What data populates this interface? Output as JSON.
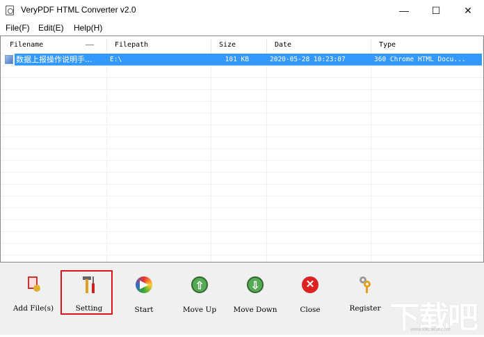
{
  "window": {
    "title": "VeryPDF HTML Converter v2.0",
    "minimize": "—",
    "maximize": "☐",
    "close": "✕"
  },
  "menu": [
    {
      "label": "File(F)"
    },
    {
      "label": "Edit(E)"
    },
    {
      "label": "Help(H)"
    }
  ],
  "columns": [
    "Filename",
    "Filepath",
    "Size",
    "Date",
    "Type"
  ],
  "rows": [
    {
      "filename": "数据上报操作说明手...",
      "filepath": "E:\\",
      "size": "101 KB",
      "date": "2020-05-28 10:23:07",
      "type": "360 Chrome HTML Docu..."
    }
  ],
  "toolbar": [
    {
      "label": "Add File(s)",
      "icon": "add-file-icon"
    },
    {
      "label": "Setting",
      "icon": "tools-icon"
    },
    {
      "label": "Start",
      "icon": "start-icon"
    },
    {
      "label": "Move Up",
      "icon": "arrow-up-icon"
    },
    {
      "label": "Move Down",
      "icon": "arrow-down-icon"
    },
    {
      "label": "Close",
      "icon": "close-x-icon"
    },
    {
      "label": "Register",
      "icon": "keys-icon"
    }
  ],
  "watermark": {
    "text": "下载吧",
    "url": "www.xiazaiba.com"
  },
  "colors": {
    "selection": "#3399ff",
    "highlight": "#d9141b"
  }
}
